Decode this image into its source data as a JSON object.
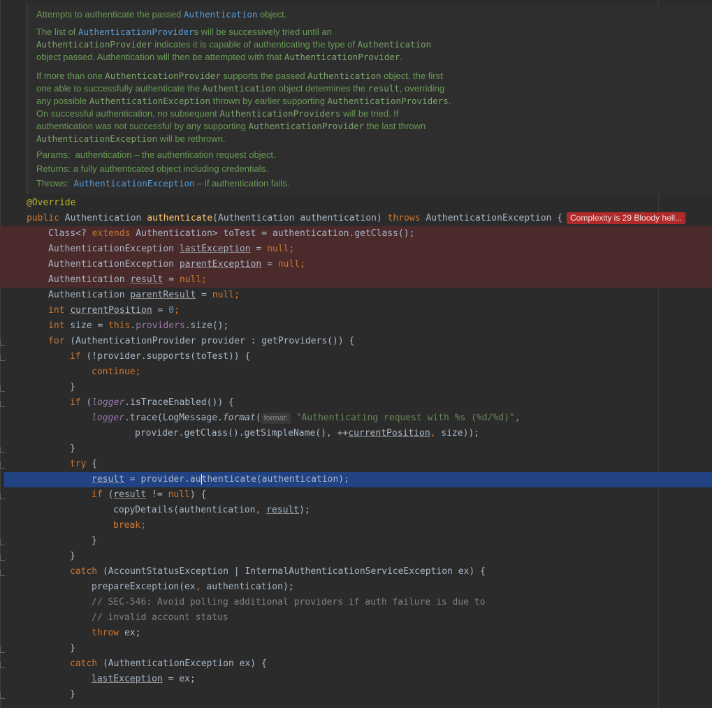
{
  "doc": {
    "p1": {
      "a": "Attempts to authenticate the passed ",
      "b": "Authentication",
      "c": " object."
    },
    "p2": {
      "l1": {
        "a": "The list of ",
        "b": "AuthenticationProvider",
        "c": "s will be successively tried until an"
      },
      "l2": {
        "a": "AuthenticationProvider",
        "b": " indicates it is capable of authenticating the type of ",
        "c": "Authentication"
      },
      "l3": {
        "a": "object passed. Authentication will then be attempted with that ",
        "b": "AuthenticationProvider",
        "c": "."
      }
    },
    "p3": {
      "l1": {
        "a": "If more than one ",
        "b": "AuthenticationProvider",
        "c": " supports the passed ",
        "d": "Authentication",
        "e": " object, the first"
      },
      "l2": {
        "a": "one able to successfully authenticate the ",
        "b": "Authentication",
        "c": " object determines the ",
        "d": "result",
        "e": ", overriding"
      },
      "l3": {
        "a": "any possible ",
        "b": "AuthenticationException",
        "c": " thrown by earlier supporting ",
        "d": "AuthenticationProviders",
        "e": "."
      },
      "l4": {
        "a": "On successful authentication, no subsequent ",
        "b": "AuthenticationProviders",
        "c": " will be tried. If"
      },
      "l5": {
        "a": "authentication was not successful by any supporting ",
        "b": "AuthenticationProvider",
        "c": " the last thrown"
      },
      "l6": {
        "a": "AuthenticationException",
        "b": " will be rethrown."
      }
    },
    "params": {
      "label": "Params:",
      "text": "authentication – the authentication request object."
    },
    "returns": {
      "label": "Returns:",
      "text": "a fully authenticated object including credentials."
    },
    "throws": {
      "label": "Throws:",
      "link": "AuthenticationException",
      "text": " – if authentication fails."
    }
  },
  "complexity_badge": "Complexity is 29 Bloody hell...",
  "code": {
    "l01": {
      "a": "@Override"
    },
    "l02": {
      "a": "public",
      "b": " Authentication ",
      "c": "authenticate",
      "d": "(Authentication authentication) ",
      "e": "throws",
      "f": " AuthenticationException {"
    },
    "l03": {
      "a": "Class<? ",
      "b": "extends",
      "c": " Authentication> toTest = authentication.getClass();"
    },
    "l04": {
      "a": "AuthenticationException ",
      "b": "lastException",
      "c": " = ",
      "d": "null",
      ";": ";"
    },
    "l05": {
      "a": "AuthenticationException ",
      "b": "parentException",
      "c": " = ",
      "d": "null",
      ";": ";"
    },
    "l06": {
      "a": "Authentication ",
      "b": "result",
      "c": " = ",
      "d": "null",
      ";": ";"
    },
    "l07": {
      "a": "Authentication ",
      "b": "parentResult",
      "c": " = ",
      "d": "null",
      ";": ";"
    },
    "l08": {
      "a": "int",
      "b": " ",
      "c": "currentPosition",
      "d": " = ",
      "e": "0",
      ";": ";"
    },
    "l09": {
      "a": "int",
      "b": " size = ",
      "c": "this",
      "d": ".",
      "e": "providers",
      "f": ".size();"
    },
    "l10": {
      "a": "for",
      "b": " (AuthenticationProvider provider : getProviders()) {"
    },
    "l11": {
      "a": "if",
      "b": " (!provider.supports(toTest)) {"
    },
    "l12": {
      "a": "continue",
      ";": ";"
    },
    "l13": {
      "a": "}"
    },
    "l14": {
      "a": "if",
      "b": " (",
      "c": "logger",
      "d": ".isTraceEnabled()) {"
    },
    "l15": {
      "a": "logger",
      "b": ".trace(LogMessage.",
      "c": "format",
      "d": "(",
      "hint": "format:",
      "e": "\"Authenticating request with %s (%d/%d)\"",
      "f": ","
    },
    "l16": {
      "a": "provider.getClass().getSimpleName(), ++",
      "b": "currentPosition",
      ",": ",",
      "c": " size));"
    },
    "l17": {
      "a": "}"
    },
    "l18": {
      "a": "try",
      "b": " {"
    },
    "l19": {
      "a": "result",
      "b": " = provider.au",
      "c": "thenticate(authentication);"
    },
    "l20": {
      "a": "if",
      "b": " (",
      "c": "result",
      "d": " != ",
      "e": "null",
      "f": ") {"
    },
    "l21": {
      "a": "copyDetails(authentication",
      ",": ",",
      "b": " ",
      "c": "result",
      "d": ");"
    },
    "l22": {
      "a": "break",
      ";": ";"
    },
    "l23": {
      "a": "}"
    },
    "l24": {
      "a": "}"
    },
    "l25": {
      "a": "catch",
      "b": " (AccountStatusException | InternalAuthenticationServiceException ex) {"
    },
    "l26": {
      "a": "prepareException(ex",
      ",": ",",
      "b": " authentication);"
    },
    "l27": {
      "a": "// SEC-546: Avoid polling additional providers if auth failure is due to"
    },
    "l28": {
      "a": "// invalid account status"
    },
    "l29": {
      "a": "throw",
      "b": " ex;"
    },
    "l30": {
      "a": "}"
    },
    "l31": {
      "a": "catch",
      "b": " (AuthenticationException ex) {"
    },
    "l32": {
      "a": "lastException",
      "b": " = ex;"
    },
    "l33": {
      "a": "}"
    }
  },
  "colors": {
    "keyword": "#cc7832",
    "annotation": "#bbb529",
    "method": "#ffc66d",
    "field": "#9876aa",
    "string": "#6a8759",
    "number": "#6897bb",
    "comment": "#808080",
    "highlight": "#4a2a2a",
    "selection": "#214283",
    "badge": "#b02a2a"
  }
}
